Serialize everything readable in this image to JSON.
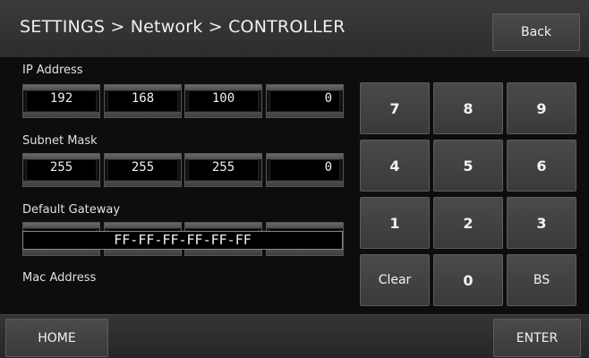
{
  "header": {
    "title": "SETTINGS > Network > CONTROLLER",
    "back_label": "Back"
  },
  "ip_address": {
    "label": "IP Address",
    "octets": [
      "192",
      "168",
      "100",
      "0"
    ]
  },
  "subnet_mask": {
    "label": "Subnet Mask",
    "octets": [
      "255",
      "255",
      "255",
      "0"
    ]
  },
  "default_gateway": {
    "label": "Default Gateway",
    "octets": [
      "",
      "",
      "",
      ""
    ]
  },
  "mac_address": {
    "label": "Mac Address",
    "value": "FF-FF-FF-FF-FF-FF"
  },
  "keypad": {
    "keys": [
      "7",
      "8",
      "9",
      "4",
      "5",
      "6",
      "1",
      "2",
      "3",
      "Clear",
      "0",
      "BS"
    ]
  },
  "footer": {
    "home_label": "HOME",
    "enter_label": "ENTER"
  }
}
